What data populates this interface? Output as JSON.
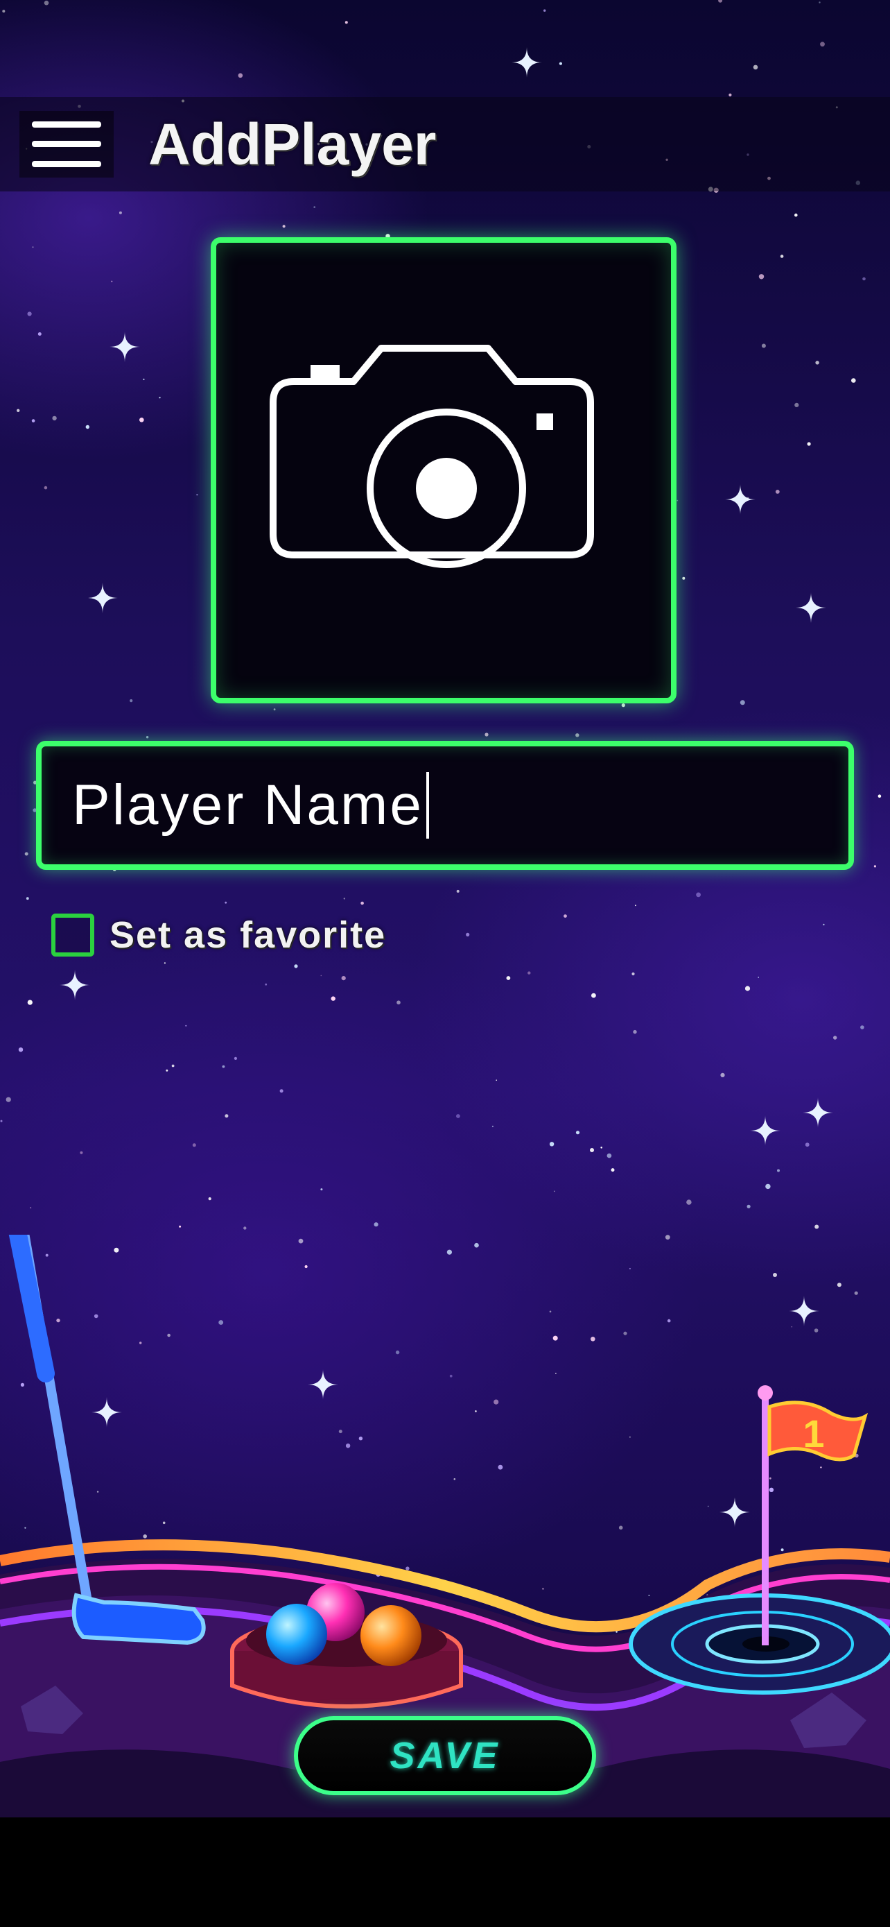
{
  "header": {
    "title": "AddPlayer",
    "menu_icon": "hamburger-menu-icon"
  },
  "photo": {
    "icon": "camera-icon",
    "border_color": "#3cff6b"
  },
  "name_input": {
    "value": "Player Name"
  },
  "favorite": {
    "label": "Set as favorite",
    "checked": false,
    "border_color": "#2bd13f"
  },
  "scene": {
    "flag_number": "1"
  },
  "save_button": {
    "label": "SAVE",
    "text_color": "#2fe3c3"
  },
  "colors": {
    "accent_green": "#3cff6b",
    "background": "#1d0e5a"
  }
}
